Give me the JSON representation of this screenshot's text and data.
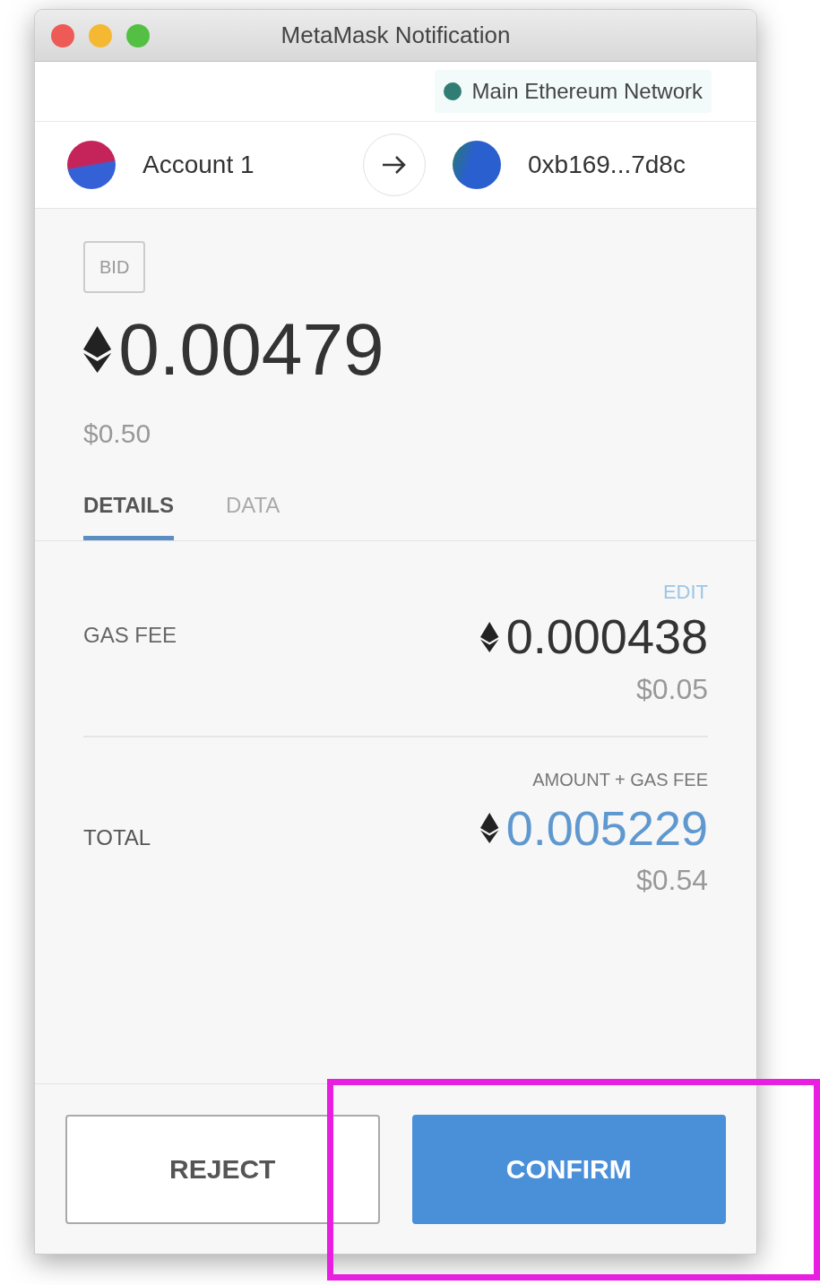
{
  "window": {
    "title": "MetaMask Notification"
  },
  "network": {
    "name": "Main Ethereum Network"
  },
  "sender": {
    "name": "Account 1"
  },
  "recipient": {
    "address": "0xb169...7d8c"
  },
  "transaction": {
    "method": "BID",
    "amount": "0.00479",
    "fiat": "$0.50"
  },
  "tabs": [
    {
      "label": "DETAILS",
      "selected": true
    },
    {
      "label": "DATA",
      "selected": false
    }
  ],
  "details": {
    "gas_fee": {
      "label": "GAS FEE",
      "action": "EDIT",
      "amount": "0.000438",
      "fiat": "$0.05"
    },
    "total": {
      "label": "TOTAL",
      "note": "AMOUNT + GAS FEE",
      "amount": "0.005229",
      "fiat": "$0.54"
    }
  },
  "buttons": [
    {
      "label": "REJECT",
      "kind": "secondary",
      "highlighted": false
    },
    {
      "label": "CONFIRM",
      "kind": "primary",
      "highlighted": true
    }
  ]
}
